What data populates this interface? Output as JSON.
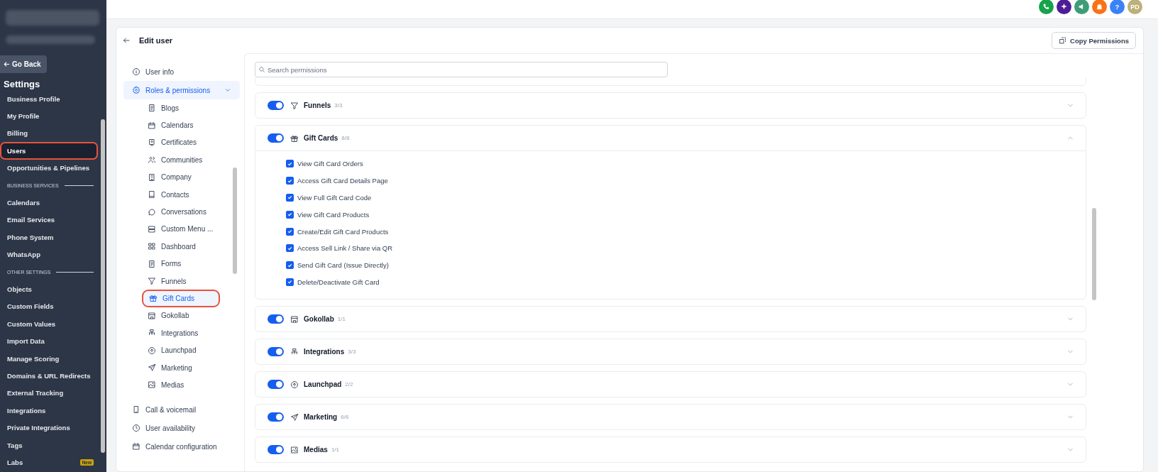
{
  "header_actions": [
    {
      "color": "#16a34a"
    },
    {
      "color": "#4c1d95"
    },
    {
      "color": "#3f9c78"
    },
    {
      "color": "#f97316"
    },
    {
      "color": "#3b82f6",
      "label": "?"
    },
    {
      "color": "#bdb07a",
      "label": "PD"
    }
  ],
  "sidebar": {
    "back_button": "Go Back",
    "title": "Settings",
    "items": [
      {
        "kind": "item",
        "label": "Business Profile",
        "selected": false
      },
      {
        "kind": "item",
        "label": "My Profile",
        "selected": false
      },
      {
        "kind": "item",
        "label": "Billing",
        "selected": false
      },
      {
        "kind": "item",
        "label": "Users",
        "selected": true
      },
      {
        "kind": "item",
        "label": "Opportunities & Pipelines",
        "selected": false
      },
      {
        "kind": "header",
        "label": "BUSINESS SERVICES"
      },
      {
        "kind": "item",
        "label": "Calendars",
        "selected": false
      },
      {
        "kind": "item",
        "label": "Email Services",
        "selected": false
      },
      {
        "kind": "item",
        "label": "Phone System",
        "selected": false
      },
      {
        "kind": "item",
        "label": "WhatsApp",
        "selected": false
      },
      {
        "kind": "header",
        "label": "OTHER SETTINGS"
      },
      {
        "kind": "item",
        "label": "Objects",
        "selected": false
      },
      {
        "kind": "item",
        "label": "Custom Fields",
        "selected": false
      },
      {
        "kind": "item",
        "label": "Custom Values",
        "selected": false
      },
      {
        "kind": "item",
        "label": "Import Data",
        "selected": false
      },
      {
        "kind": "item",
        "label": "Manage Scoring",
        "selected": false
      },
      {
        "kind": "item",
        "label": "Domains & URL Redirects",
        "selected": false
      },
      {
        "kind": "item",
        "label": "External Tracking",
        "selected": false
      },
      {
        "kind": "item",
        "label": "Integrations",
        "selected": false
      },
      {
        "kind": "item",
        "label": "Private Integrations",
        "selected": false
      },
      {
        "kind": "item",
        "label": "Tags",
        "selected": false
      },
      {
        "kind": "item",
        "label": "Labs",
        "selected": false,
        "badge": "New"
      }
    ]
  },
  "page": {
    "title": "Edit user",
    "copy_button": "Copy Permissions"
  },
  "nav": {
    "top": [
      {
        "label": "User info",
        "selected": false
      }
    ],
    "roles": {
      "label": "Roles & permissions",
      "selected": true,
      "expanded": true,
      "children": [
        {
          "label": "Blogs",
          "selected": false
        },
        {
          "label": "Calendars",
          "selected": false
        },
        {
          "label": "Certificates",
          "selected": false
        },
        {
          "label": "Communities",
          "selected": false
        },
        {
          "label": "Company",
          "selected": false
        },
        {
          "label": "Contacts",
          "selected": false
        },
        {
          "label": "Conversations",
          "selected": false
        },
        {
          "label": "Custom Menu ...",
          "selected": false
        },
        {
          "label": "Dashboard",
          "selected": false
        },
        {
          "label": "Forms",
          "selected": false
        },
        {
          "label": "Funnels",
          "selected": false
        },
        {
          "label": "Gift Cards",
          "selected": true
        },
        {
          "label": "Gokollab",
          "selected": false
        },
        {
          "label": "Integrations",
          "selected": false
        },
        {
          "label": "Launchpad",
          "selected": false
        },
        {
          "label": "Marketing",
          "selected": false
        },
        {
          "label": "Medias",
          "selected": false
        }
      ]
    },
    "bottom": [
      {
        "label": "Call & voicemail",
        "selected": false
      },
      {
        "label": "User availability",
        "selected": false
      },
      {
        "label": "Calendar configuration",
        "selected": false
      }
    ]
  },
  "search": {
    "placeholder": "Search permissions"
  },
  "sections": [
    {
      "label": "Funnels",
      "count": "3/3",
      "enabled": true,
      "expanded": false
    },
    {
      "label": "Gift Cards",
      "count": "8/8",
      "enabled": true,
      "expanded": true,
      "permissions": [
        {
          "label": "View Gift Card Orders",
          "checked": true
        },
        {
          "label": "Access Gift Card Details Page",
          "checked": true
        },
        {
          "label": "View Full Gift Card Code",
          "checked": true
        },
        {
          "label": "View Gift Card Products",
          "checked": true
        },
        {
          "label": "Create/Edit Gift Card Products",
          "checked": true
        },
        {
          "label": "Access Sell Link / Share via QR",
          "checked": true
        },
        {
          "label": "Send Gift Card (Issue Directly)",
          "checked": true
        },
        {
          "label": "Delete/Deactivate Gift Card",
          "checked": true
        }
      ]
    },
    {
      "label": "Gokollab",
      "count": "1/1",
      "enabled": true,
      "expanded": false
    },
    {
      "label": "Integrations",
      "count": "3/3",
      "enabled": true,
      "expanded": false
    },
    {
      "label": "Launchpad",
      "count": "2/2",
      "enabled": true,
      "expanded": false
    },
    {
      "label": "Marketing",
      "count": "6/6",
      "enabled": true,
      "expanded": false
    },
    {
      "label": "Medias",
      "count": "1/1",
      "enabled": true,
      "expanded": false
    }
  ]
}
